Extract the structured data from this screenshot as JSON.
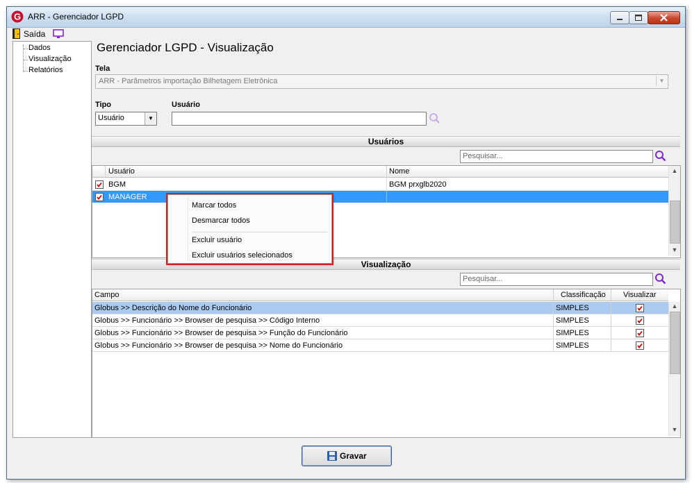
{
  "window": {
    "title": "ARR - Gerenciador LGPD"
  },
  "toolbar": {
    "exit_label": "Saída"
  },
  "tree": {
    "items": [
      {
        "label": "Dados"
      },
      {
        "label": "Visualização"
      },
      {
        "label": "Relatórios"
      }
    ]
  },
  "main": {
    "page_title": "Gerenciador LGPD - Visualização",
    "tela_label": "Tela",
    "tela_value": "ARR - Parâmetros importação Bilhetagem Eletrônica",
    "tipo_label": "Tipo",
    "tipo_value": "Usuário",
    "usuario_label": "Usuário",
    "usuario_value": ""
  },
  "usuarios": {
    "section_title": "Usuários",
    "search_placeholder": "Pesquisar...",
    "columns": [
      "Usuário",
      "Nome"
    ],
    "rows": [
      {
        "checked": true,
        "usuario": "BGM",
        "nome": "BGM prxglb2020",
        "selected": false
      },
      {
        "checked": true,
        "usuario": "MANAGER",
        "nome": "",
        "selected": true
      }
    ]
  },
  "context_menu": {
    "items": [
      "Marcar todos",
      "Desmarcar todos",
      "Excluir usuário",
      "Excluir usuários selecionados"
    ]
  },
  "visualizacao": {
    "section_title": "Visualização",
    "search_placeholder": "Pesquisar...",
    "columns": [
      "Campo",
      "Classificação",
      "Visualizar"
    ],
    "rows": [
      {
        "campo": "Globus >> Descrição do Nome do Funcionário",
        "classificacao": "SIMPLES",
        "visualizar": true,
        "selected": true
      },
      {
        "campo": "Globus >> Funcionário >> Browser de pesquisa >> Código Interno",
        "classificacao": "SIMPLES",
        "visualizar": true,
        "selected": false
      },
      {
        "campo": "Globus >> Funcionário >> Browser de pesquisa >> Função do Funcionário",
        "classificacao": "SIMPLES",
        "visualizar": true,
        "selected": false
      },
      {
        "campo": "Globus >> Funcionário >> Browser de pesquisa >> Nome do Funcionário",
        "classificacao": "SIMPLES",
        "visualizar": true,
        "selected": false
      }
    ]
  },
  "save_button": {
    "label": "Gravar"
  },
  "colors": {
    "selection": "#3399ff",
    "selection_light": "#aacaf0",
    "context_menu_outline": "#cc2222",
    "search_icon": "#7a2ad0",
    "checkbox_mark": "#cc0000"
  }
}
